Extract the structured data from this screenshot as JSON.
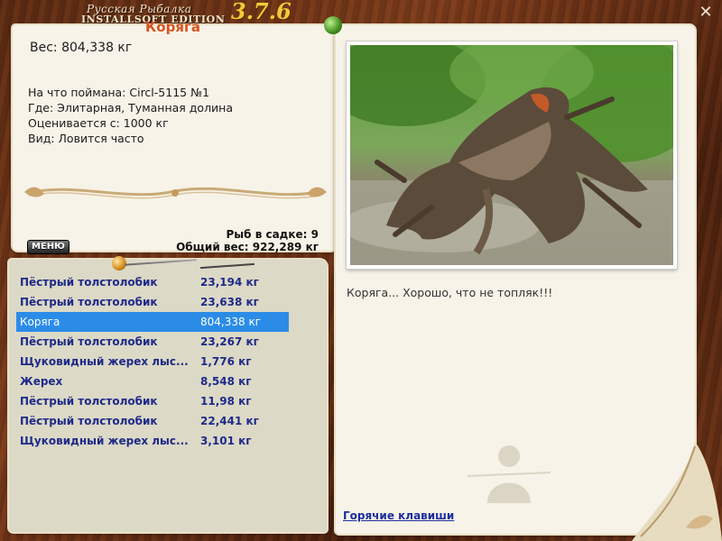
{
  "window": {
    "logo_line1": "Русская Рыбалка",
    "logo_line2": "INSTALLSOFT EDITION",
    "version": "3.7.6",
    "close_icon": "close-icon"
  },
  "details": {
    "title": "Коряга",
    "weight_line": "Вес: 804,338 кг",
    "lines": [
      "На что поймана: Circl-5115 №1",
      "Где: Элитарная, Туманная долина",
      "Оценивается с: 1000 кг",
      "Вид: Ловится часто"
    ]
  },
  "menu_label": "МЕНЮ",
  "stats": {
    "fish_in_keepnet": "Рыб в садке: 9",
    "total_weight": "Общий вес: 922,289 кг"
  },
  "catch_list": [
    {
      "name": "Пёстрый толстолобик",
      "weight": "23,194 кг"
    },
    {
      "name": "Пёстрый толстолобик",
      "weight": "23,638 кг"
    },
    {
      "name": "Коряга",
      "weight": "804,338 кг",
      "selected": true
    },
    {
      "name": "Пёстрый толстолобик",
      "weight": "23,267 кг"
    },
    {
      "name": "Щуковидный жерех лыс...",
      "weight": "1,776 кг"
    },
    {
      "name": "Жерех",
      "weight": "8,548 кг"
    },
    {
      "name": "Пёстрый толстолобик",
      "weight": "11,98 кг"
    },
    {
      "name": "Пёстрый толстолобик",
      "weight": "22,441 кг"
    },
    {
      "name": "Щуковидный жерех лыс...",
      "weight": "3,101 кг"
    }
  ],
  "photo_caption": "Коряга... Хорошо, что не топляк!!!",
  "hotkeys_link": "Горячие клавиши",
  "colors": {
    "title_accent": "#d9531e",
    "list_text": "#1e2a8a",
    "selection": "#2b8ce8",
    "version": "#f3c93a",
    "link": "#1d2fa0"
  }
}
